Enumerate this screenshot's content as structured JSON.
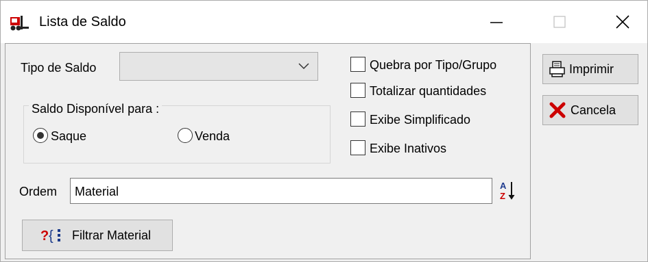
{
  "window": {
    "title": "Lista de Saldo",
    "icon": "forklift-app-icon",
    "controls": [
      "minimize-icon",
      "maximize-icon",
      "close-icon"
    ]
  },
  "form": {
    "tipo_saldo_label": "Tipo de Saldo",
    "tipo_saldo_value": "",
    "group_title": "Saldo Disponível para :",
    "radio_saque": "Saque",
    "radio_venda": "Venda",
    "radio_selected": "Saque",
    "checkboxes": {
      "quebra": "Quebra por Tipo/Grupo",
      "totalizar": "Totalizar quantidades",
      "simplificado": "Exibe Simplificado",
      "inativos": "Exibe Inativos"
    },
    "checked": [],
    "ordem_label": "Ordem",
    "ordem_value": "Material",
    "filtrar_button": "Filtrar Material"
  },
  "sidebar": {
    "imprimir_button": "Imprimir",
    "cancela_button": "Cancela"
  },
  "colors": {
    "accent_red": "#cc0000",
    "filter_blue": "#1a3a8a",
    "sort_blue": "#1f3b8f"
  }
}
